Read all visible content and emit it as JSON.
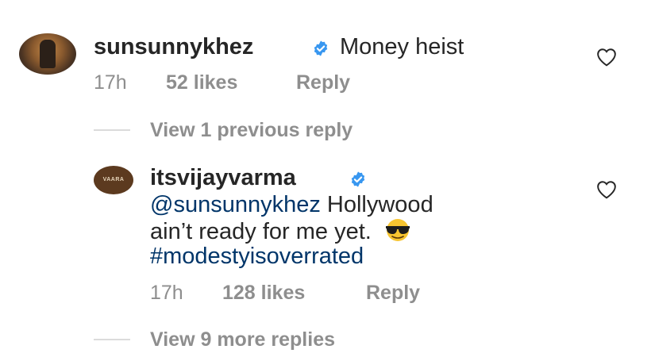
{
  "comments": [
    {
      "username": "sunsunnykhez",
      "text": "Money heist",
      "time": "17h",
      "likes": "52 likes",
      "reply": "Reply"
    },
    {
      "username": "itsvijayvarma",
      "mention": "@sunsunnykhez",
      "text_line1": "Hollywood",
      "text_line2": "ain’t ready for me yet.",
      "hashtag": "#modestyisoverrated",
      "time": "17h",
      "likes": "128 likes",
      "reply": "Reply",
      "avatar_text": "VAARA"
    }
  ],
  "view_previous": "View 1 previous reply",
  "view_more": "View 9 more replies",
  "icons": {
    "verified": "verified-badge-icon",
    "heart": "heart-outline-icon",
    "emoji": "sunglasses-emoji-icon"
  },
  "colors": {
    "verified": "#3897f0",
    "link": "#003569",
    "meta": "#8e8e8e"
  }
}
